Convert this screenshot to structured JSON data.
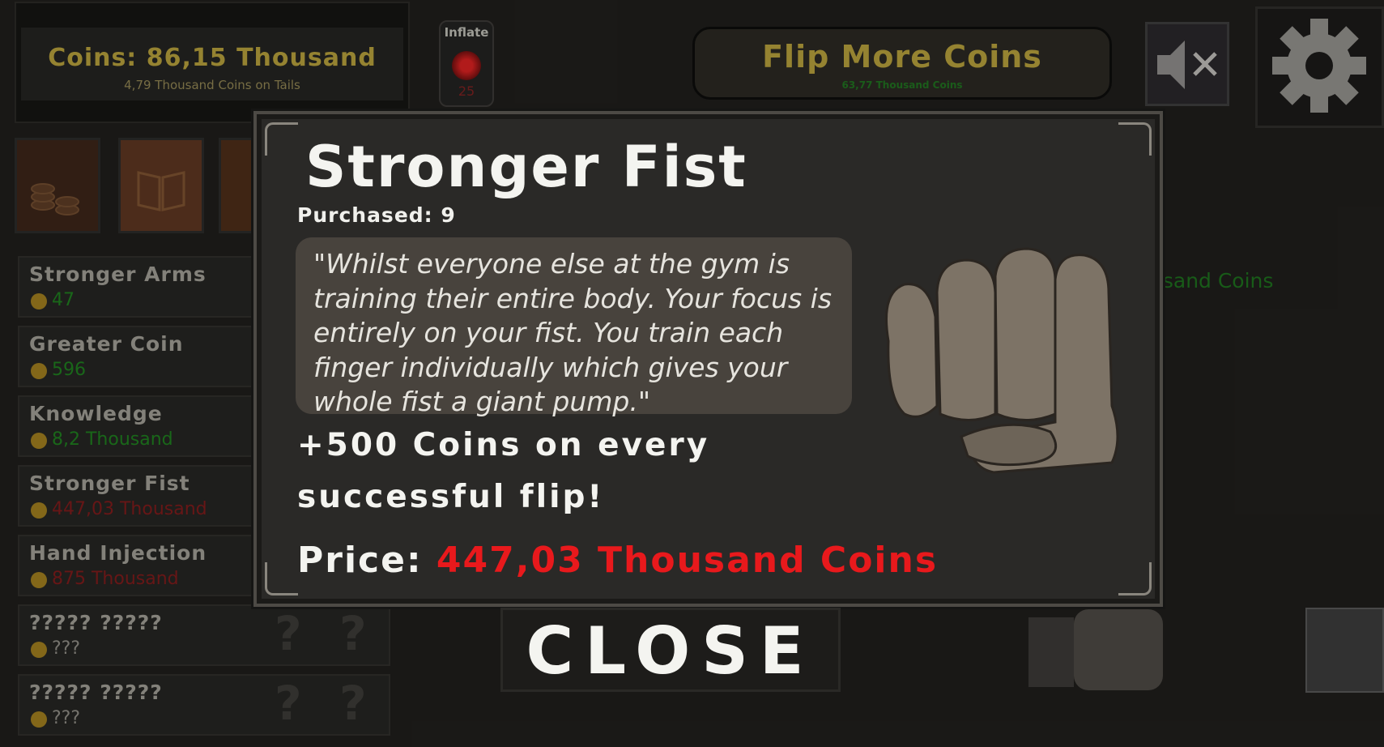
{
  "header": {
    "coins_title": "Coins: 86,15 Thousand",
    "coins_sub": "4,79 Thousand Coins on Tails",
    "inflate_label": "Inflate",
    "inflate_count": "25",
    "flip_label": "Flip More Coins",
    "flip_sub": "63,77 Thousand Coins"
  },
  "icons": {
    "mute": "speaker-muted-icon",
    "settings": "gear-icon",
    "coins_tab": "coin-stack-icon",
    "book_tab": "book-icon"
  },
  "shop_items": [
    {
      "name": "Stronger Arms",
      "price": "47",
      "price_color": "#1e7a1e"
    },
    {
      "name": "Greater Coin",
      "price": "596",
      "price_color": "#1e7a1e"
    },
    {
      "name": "Knowledge",
      "price": "8,2 Thousand",
      "price_color": "#1e7a1e"
    },
    {
      "name": "Stronger Fist",
      "price": "447,03 Thousand",
      "price_color": "#7a1a1a"
    },
    {
      "name": "Hand Injection",
      "price": "875 Thousand",
      "price_color": "#7a1a1a"
    },
    {
      "name": "????? ?????",
      "price": "???",
      "price_color": "#8a8880"
    },
    {
      "name": "????? ?????",
      "price": "???",
      "price_color": "#8a8880"
    }
  ],
  "background_text": "usand Coins",
  "modal": {
    "title": "Stronger Fist",
    "purchased": "Purchased: 9",
    "quote": "\"Whilst everyone else at the gym is training their entire body. Your focus is entirely on your fist. You train each finger individually which gives your whole fist a giant pump.\"",
    "effect": "+500 Coins on every successful flip!",
    "price_label": "Price:",
    "price_value": "447,03 Thousand Coins",
    "close_label": "CLOSE"
  },
  "colors": {
    "gold": "#b09a3a",
    "price_red": "#e8191c",
    "green": "#1e7a1e"
  }
}
